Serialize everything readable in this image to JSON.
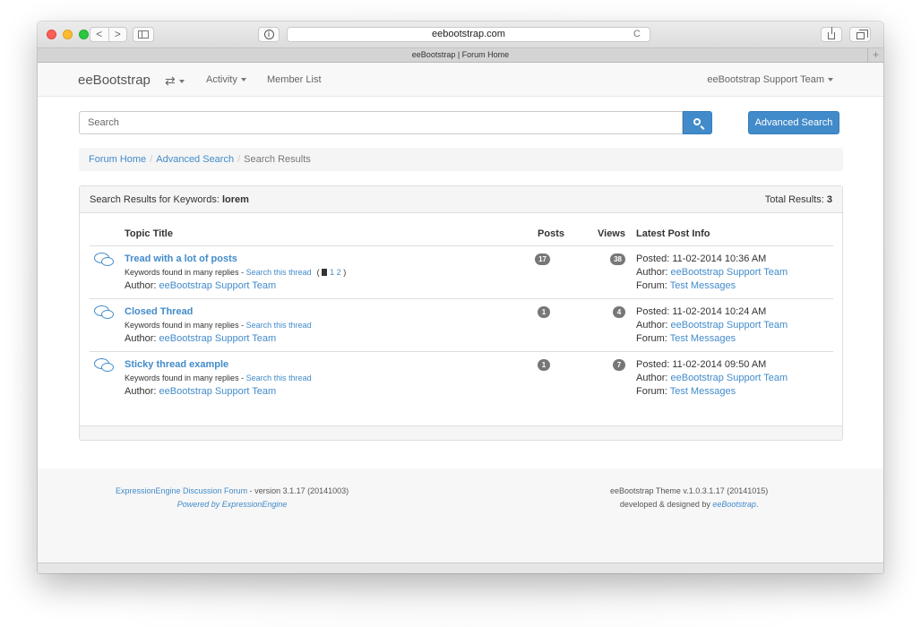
{
  "browser": {
    "url": "eebootstrap.com",
    "tab_title": "eeBootstrap | Forum Home",
    "back_glyph": "<",
    "forward_glyph": ">",
    "reload_glyph": "C",
    "reader_glyph": "i",
    "new_tab_glyph": "+"
  },
  "navbar": {
    "brand": "eeBootstrap",
    "swap_glyph": "⇄",
    "activity": "Activity",
    "member_list": "Member List",
    "user": "eeBootstrap Support Team"
  },
  "search": {
    "placeholder": "Search",
    "advanced_label": "Advanced Search"
  },
  "breadcrumb": {
    "items": [
      "Forum Home",
      "Advanced Search",
      "Search Results"
    ],
    "separator": "/"
  },
  "results": {
    "heading_prefix": "Search Results for Keywords: ",
    "keyword": "lorem",
    "total_prefix": "Total Results: ",
    "total": "3",
    "columns": {
      "topic": "Topic Title",
      "posts": "Posts",
      "views": "Views",
      "info": "Latest Post Info"
    },
    "rows": [
      {
        "title": "Tread with a lot of posts",
        "keywords_text": "Keywords found in many replies - ",
        "search_link": "Search this thread",
        "pages_open": "(",
        "pages": [
          "1",
          "2"
        ],
        "pages_close": ")",
        "author_label": "Author: ",
        "author": "eeBootstrap Support Team",
        "posts": "17",
        "views": "38",
        "posted": "Posted: 11-02-2014 10:36 AM",
        "last_author_label": "Author: ",
        "last_author": "eeBootstrap Support Team",
        "forum_label": "Forum: ",
        "forum": "Test Messages"
      },
      {
        "title": "Closed Thread",
        "keywords_text": "Keywords found in many replies - ",
        "search_link": "Search this thread",
        "author_label": "Author: ",
        "author": "eeBootstrap Support Team",
        "posts": "1",
        "views": "4",
        "posted": "Posted: 11-02-2014 10:24 AM",
        "last_author_label": "Author: ",
        "last_author": "eeBootstrap Support Team",
        "forum_label": "Forum: ",
        "forum": "Test Messages"
      },
      {
        "title": "Sticky thread example",
        "keywords_text": "Keywords found in many replies - ",
        "search_link": "Search this thread",
        "author_label": "Author: ",
        "author": "eeBootstrap Support Team",
        "posts": "1",
        "views": "7",
        "posted": "Posted: 11-02-2014 09:50 AM",
        "last_author_label": "Author: ",
        "last_author": "eeBootstrap Support Team",
        "forum_label": "Forum: ",
        "forum": "Test Messages"
      }
    ]
  },
  "footer": {
    "left_link": "ExpressionEngine Discussion Forum",
    "left_version": " - version 3.1.17 (20141003)",
    "left_powered": "Powered by ExpressionEngine",
    "right_theme": "eeBootstrap Theme v.1.0.3.1.17 (20141015)",
    "right_dev": "developed & designed by ",
    "right_link": "eeBootstrap",
    "right_end": "."
  },
  "colors": {
    "accent": "#428bca",
    "badge": "#777777"
  }
}
